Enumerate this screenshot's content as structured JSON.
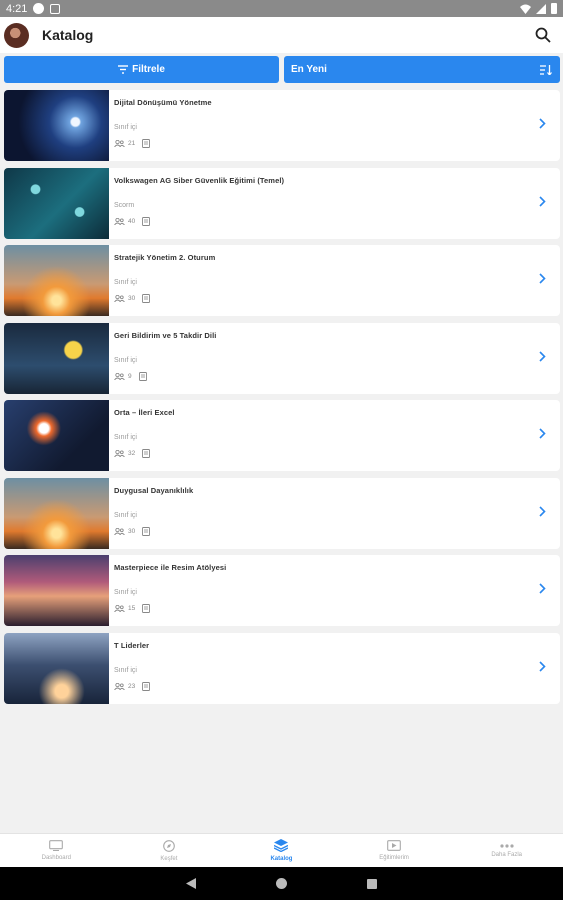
{
  "status_bar": {
    "time": "4:21"
  },
  "app_bar": {
    "title": "Katalog"
  },
  "toolbar": {
    "filter_label": "Filtrele",
    "sort_label": "En Yeni"
  },
  "courses": [
    {
      "title": "Dijital Dönüşümü Yönetme",
      "type": "Sınıf içi",
      "count": "21"
    },
    {
      "title": "Volkswagen AG Siber Güvenlik Eğitimi (Temel)",
      "type": "Scorm",
      "count": "40"
    },
    {
      "title": "Stratejik Yönetim 2. Oturum",
      "type": "Sınıf içi",
      "count": "30"
    },
    {
      "title": "Geri Bildirim ve 5 Takdir Dili",
      "type": "Sınıf içi",
      "count": "9"
    },
    {
      "title": "Orta – İleri Excel",
      "type": "Sınıf içi",
      "count": "32"
    },
    {
      "title": "Duygusal Dayanıklılık",
      "type": "Sınıf içi",
      "count": "30"
    },
    {
      "title": "Masterpiece ile Resim Atölyesi",
      "type": "Sınıf içi",
      "count": "15"
    },
    {
      "title": "T Liderler",
      "type": "Sınıf içi",
      "count": "23"
    }
  ],
  "bottom_nav": {
    "items": [
      {
        "label": "Dashboard",
        "icon": "dashboard-icon"
      },
      {
        "label": "Keşfet",
        "icon": "compass-icon"
      },
      {
        "label": "Katalog",
        "icon": "layers-icon"
      },
      {
        "label": "Eğitimlerim",
        "icon": "trainings-icon"
      },
      {
        "label": "Daha Fazla",
        "icon": "more-icon"
      }
    ],
    "active": "Katalog"
  },
  "colors": {
    "accent": "#2a87ee",
    "status_bar": "#8a8a8a",
    "background": "#f1f1f1"
  }
}
